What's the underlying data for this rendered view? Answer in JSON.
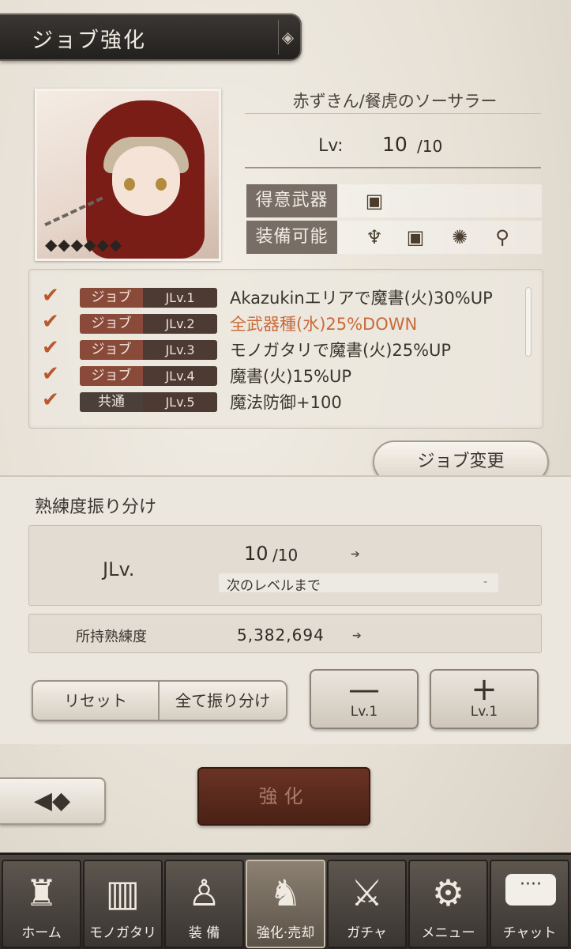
{
  "header": {
    "title": "ジョブ強化",
    "cap_icon": "diamond-ornament-icon"
  },
  "character": {
    "name": "赤ずきん/餐虎のソーサラー",
    "lv_label": "Lv:",
    "lv_value": "10",
    "lv_max": "/10",
    "stars": "◆◆◆◆◆◆",
    "weapon_rows": [
      {
        "label": "得意武器",
        "icons": [
          "tome-icon"
        ]
      },
      {
        "label": "装備可能",
        "icons": [
          "harp-icon",
          "tome-icon",
          "orb-icon",
          "staff-icon"
        ]
      }
    ]
  },
  "skills": [
    {
      "type": "ジョブ",
      "lv": "JLv.1",
      "text": "Akazukinエリアで魔書(火)30%UP",
      "color": "#3a342e"
    },
    {
      "type": "ジョブ",
      "lv": "JLv.2",
      "text": "全武器種(水)25%DOWN",
      "color": "#c86a3a"
    },
    {
      "type": "ジョブ",
      "lv": "JLv.3",
      "text": "モノガタリで魔書(火)25%UP",
      "color": "#3a342e"
    },
    {
      "type": "ジョブ",
      "lv": "JLv.4",
      "text": "魔書(火)15%UP",
      "color": "#3a342e"
    },
    {
      "type": "共通",
      "lv": "JLv.5",
      "text": "魔法防御+100",
      "color": "#3a342e"
    }
  ],
  "job_change_label": "ジョブ変更",
  "mastery": {
    "title": "熟練度振り分け",
    "jlv_label": "JLv.",
    "jlv_value": "10",
    "jlv_max": "/10",
    "next_label": "次のレベルまで",
    "next_value": "-",
    "owned_label": "所持熟練度",
    "owned_value": "5,382,694"
  },
  "buttons": {
    "reset": "リセット",
    "allocate_all": "全て振り分け",
    "minus_symbol": "—",
    "minus_lv": "Lv.1",
    "plus_symbol": "+",
    "plus_lv": "Lv.1",
    "enhance": "強化"
  },
  "nav": [
    {
      "label": "ホーム",
      "icon": "castle-icon",
      "active": false
    },
    {
      "label": "モノガタリ",
      "icon": "book-icon",
      "active": false
    },
    {
      "label": "装 備",
      "icon": "puppet-icon",
      "active": false
    },
    {
      "label": "強化·売却",
      "icon": "mask-icon",
      "active": true
    },
    {
      "label": "ガチャ",
      "icon": "crossed-swords-icon",
      "active": false
    },
    {
      "label": "メニュー",
      "icon": "gears-icon",
      "active": false
    },
    {
      "label": "チャット",
      "icon": "chat-bubble-icon",
      "active": false
    }
  ],
  "colors": {
    "accent": "#5a2a1c",
    "check": "#b9572d",
    "down_text": "#c86a3a"
  }
}
